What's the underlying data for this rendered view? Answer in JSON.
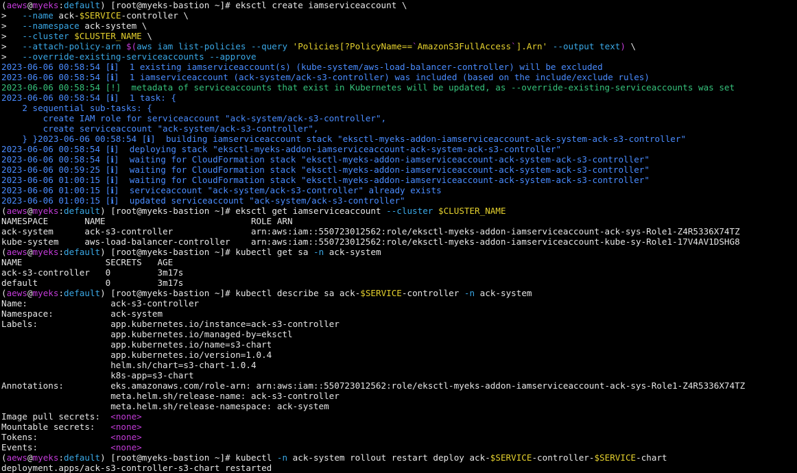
{
  "terminal": {
    "lines": [
      [
        [
          "w",
          "("
        ],
        [
          "m",
          "aews"
        ],
        [
          "w",
          "@"
        ],
        [
          "m",
          "myeks"
        ],
        [
          "w",
          ":"
        ],
        [
          "c",
          "default"
        ],
        [
          "w",
          ") [root@myeks-bastion ~]# eksctl create iamserviceaccount \\"
        ]
      ],
      [
        [
          "w",
          ">   "
        ],
        [
          "c",
          "--name"
        ],
        [
          "w",
          " ack-"
        ],
        [
          "y",
          "$SERVICE"
        ],
        [
          "w",
          "-controller \\"
        ]
      ],
      [
        [
          "w",
          ">   "
        ],
        [
          "c",
          "--namespace"
        ],
        [
          "w",
          " ack-system \\"
        ]
      ],
      [
        [
          "w",
          ">   "
        ],
        [
          "c",
          "--cluster"
        ],
        [
          "w",
          " "
        ],
        [
          "y",
          "$CLUSTER_NAME"
        ],
        [
          "w",
          " \\"
        ]
      ],
      [
        [
          "w",
          ">   "
        ],
        [
          "c",
          "--attach-policy-arn"
        ],
        [
          "w",
          " "
        ],
        [
          "m",
          "$("
        ],
        [
          "c",
          "aws iam list-policies --query "
        ],
        [
          "y",
          "'Policies[?PolicyName=="
        ],
        [
          "m",
          "`"
        ],
        [
          "y",
          "AmazonS3FullAccess"
        ],
        [
          "m",
          "`"
        ],
        [
          "y",
          "].Arn'"
        ],
        [
          "c",
          " --output text"
        ],
        [
          "m",
          ")"
        ],
        [
          "w",
          " \\"
        ]
      ],
      [
        [
          "w",
          ">   "
        ],
        [
          "c",
          "--override-existing-serviceaccounts --approve"
        ]
      ],
      [
        [
          "b",
          "2023-06-06 00:58:54 [ℹ]  1 existing iamserviceaccount(s) (kube-system/aws-load-balancer-controller) will be excluded"
        ]
      ],
      [
        [
          "b",
          "2023-06-06 00:58:54 [ℹ]  1 iamserviceaccount (ack-system/ack-s3-controller) was included (based on the include/exclude rules)"
        ]
      ],
      [
        [
          "g",
          "2023-06-06 00:58:54 [!]  metadata of serviceaccounts that exist in Kubernetes will be updated, as --override-existing-serviceaccounts was set"
        ]
      ],
      [
        [
          "b",
          "2023-06-06 00:58:54 [ℹ]  1 task: {"
        ]
      ],
      [
        [
          "b",
          "    2 sequential sub-tasks: {"
        ]
      ],
      [
        [
          "b",
          "        create IAM role for serviceaccount \"ack-system/ack-s3-controller\","
        ]
      ],
      [
        [
          "b",
          "        create serviceaccount \"ack-system/ack-s3-controller\","
        ]
      ],
      [
        [
          "b",
          "    } }2023-06-06 00:58:54 [ℹ]  building iamserviceaccount stack \"eksctl-myeks-addon-iamserviceaccount-ack-system-ack-s3-controller\""
        ]
      ],
      [
        [
          "b",
          "2023-06-06 00:58:54 [ℹ]  deploying stack \"eksctl-myeks-addon-iamserviceaccount-ack-system-ack-s3-controller\""
        ]
      ],
      [
        [
          "b",
          "2023-06-06 00:58:54 [ℹ]  waiting for CloudFormation stack \"eksctl-myeks-addon-iamserviceaccount-ack-system-ack-s3-controller\""
        ]
      ],
      [
        [
          "b",
          "2023-06-06 00:59:25 [ℹ]  waiting for CloudFormation stack \"eksctl-myeks-addon-iamserviceaccount-ack-system-ack-s3-controller\""
        ]
      ],
      [
        [
          "b",
          "2023-06-06 01:00:15 [ℹ]  waiting for CloudFormation stack \"eksctl-myeks-addon-iamserviceaccount-ack-system-ack-s3-controller\""
        ]
      ],
      [
        [
          "b",
          "2023-06-06 01:00:15 [ℹ]  serviceaccount \"ack-system/ack-s3-controller\" already exists"
        ]
      ],
      [
        [
          "b",
          "2023-06-06 01:00:15 [ℹ]  updated serviceaccount \"ack-system/ack-s3-controller\""
        ]
      ],
      [
        [
          "w",
          "("
        ],
        [
          "m",
          "aews"
        ],
        [
          "w",
          "@"
        ],
        [
          "m",
          "myeks"
        ],
        [
          "w",
          ":"
        ],
        [
          "c",
          "default"
        ],
        [
          "w",
          ") [root@myeks-bastion ~]# eksctl get iamserviceaccount "
        ],
        [
          "c",
          "--cluster"
        ],
        [
          "w",
          " "
        ],
        [
          "y",
          "$CLUSTER_NAME"
        ]
      ],
      [
        [
          "w",
          "NAMESPACE       NAME                            ROLE ARN"
        ]
      ],
      [
        [
          "w",
          "ack-system      ack-s3-controller               arn:aws:iam::550723012562:role/eksctl-myeks-addon-iamserviceaccount-ack-sys-Role1-Z4R5336X74TZ"
        ]
      ],
      [
        [
          "w",
          "kube-system     aws-load-balancer-controller    arn:aws:iam::550723012562:role/eksctl-myeks-addon-iamserviceaccount-kube-sy-Role1-17V4AV1DSHG8"
        ]
      ],
      [
        [
          "w",
          "("
        ],
        [
          "m",
          "aews"
        ],
        [
          "w",
          "@"
        ],
        [
          "m",
          "myeks"
        ],
        [
          "w",
          ":"
        ],
        [
          "c",
          "default"
        ],
        [
          "w",
          ") [root@myeks-bastion ~]# kubectl get sa "
        ],
        [
          "c",
          "-n"
        ],
        [
          "w",
          " ack-system"
        ]
      ],
      [
        [
          "w",
          "NAME                SECRETS   AGE"
        ]
      ],
      [
        [
          "w",
          "ack-s3-controller   0         3m17s"
        ]
      ],
      [
        [
          "w",
          "default             0         3m17s"
        ]
      ],
      [
        [
          "w",
          "("
        ],
        [
          "m",
          "aews"
        ],
        [
          "w",
          "@"
        ],
        [
          "m",
          "myeks"
        ],
        [
          "w",
          ":"
        ],
        [
          "c",
          "default"
        ],
        [
          "w",
          ") [root@myeks-bastion ~]# kubectl describe sa ack-"
        ],
        [
          "y",
          "$SERVICE"
        ],
        [
          "w",
          "-controller "
        ],
        [
          "c",
          "-n"
        ],
        [
          "w",
          " ack-system"
        ]
      ],
      [
        [
          "w",
          "Name:                ack-s3-controller"
        ]
      ],
      [
        [
          "w",
          "Namespace:           ack-system"
        ]
      ],
      [
        [
          "w",
          "Labels:              app.kubernetes.io/instance=ack-s3-controller"
        ]
      ],
      [
        [
          "w",
          "                     app.kubernetes.io/managed-by=eksctl"
        ]
      ],
      [
        [
          "w",
          "                     app.kubernetes.io/name=s3-chart"
        ]
      ],
      [
        [
          "w",
          "                     app.kubernetes.io/version=1.0.4"
        ]
      ],
      [
        [
          "w",
          "                     helm.sh/chart=s3-chart-1.0.4"
        ]
      ],
      [
        [
          "w",
          "                     k8s-app=s3-chart"
        ]
      ],
      [
        [
          "w",
          "Annotations:         eks.amazonaws.com/role-arn: arn:aws:iam::550723012562:role/eksctl-myeks-addon-iamserviceaccount-ack-sys-Role1-Z4R5336X74TZ"
        ]
      ],
      [
        [
          "w",
          "                     meta.helm.sh/release-name: ack-s3-controller"
        ]
      ],
      [
        [
          "w",
          "                     meta.helm.sh/release-namespace: ack-system"
        ]
      ],
      [
        [
          "w",
          "Image pull secrets:  "
        ],
        [
          "m",
          "<none>"
        ]
      ],
      [
        [
          "w",
          "Mountable secrets:   "
        ],
        [
          "m",
          "<none>"
        ]
      ],
      [
        [
          "w",
          "Tokens:              "
        ],
        [
          "m",
          "<none>"
        ]
      ],
      [
        [
          "w",
          "Events:              "
        ],
        [
          "m",
          "<none>"
        ]
      ],
      [
        [
          "w",
          "("
        ],
        [
          "m",
          "aews"
        ],
        [
          "w",
          "@"
        ],
        [
          "m",
          "myeks"
        ],
        [
          "w",
          ":"
        ],
        [
          "c",
          "default"
        ],
        [
          "w",
          ") [root@myeks-bastion ~]# kubectl "
        ],
        [
          "c",
          "-n"
        ],
        [
          "w",
          " ack-system rollout restart deploy ack-"
        ],
        [
          "y",
          "$SERVICE"
        ],
        [
          "w",
          "-controller-"
        ],
        [
          "y",
          "$SERVICE"
        ],
        [
          "w",
          "-chart"
        ]
      ],
      [
        [
          "w",
          "deployment.apps/ack-s3-controller-s3-chart restarted"
        ]
      ]
    ]
  }
}
